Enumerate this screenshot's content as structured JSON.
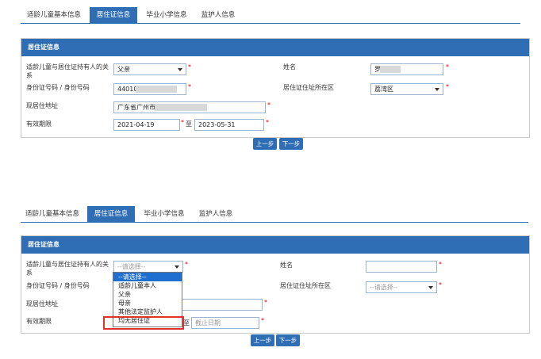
{
  "tabs": [
    "适龄儿童基本信息",
    "居住证信息",
    "毕业小学信息",
    "监护人信息"
  ],
  "panel_title": "居住证信息",
  "labels": {
    "relation": "适龄儿童与居住证持有人的关系",
    "name": "姓名",
    "id_number": "身份证号码 / 身份号码",
    "district": "居住证住址所在区",
    "address": "现居住地址",
    "validity": "有效期限",
    "to": "至"
  },
  "form1": {
    "relation": "父亲",
    "name": "罗",
    "id_number": "44010",
    "district": "荔湾区",
    "address": "广东省广州市",
    "start_date": "2021-04-19",
    "end_date": "2023-05-31"
  },
  "form2": {
    "relation": "--请选择--",
    "name": "",
    "id_number": "",
    "district": "--请选择--",
    "address": "",
    "end_date_placeholder": "截止日期"
  },
  "dropdown_options": [
    "--请选择--",
    "适龄儿童本人",
    "父亲",
    "母亲",
    "其他法定监护人",
    "均无居住证"
  ],
  "buttons": {
    "prev": "上一步",
    "next": "下一步"
  },
  "required_mark": "*",
  "colors": {
    "accent": "#2f6db5",
    "highlight": "#1e6fd0",
    "error": "#e03030"
  }
}
